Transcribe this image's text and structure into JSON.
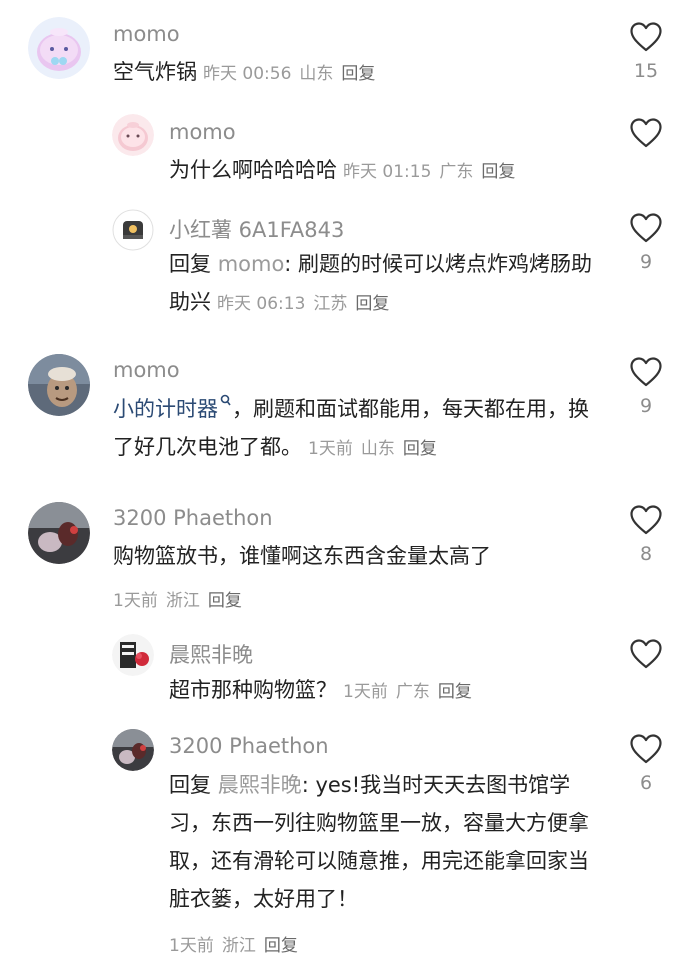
{
  "comments": [
    {
      "name": "momo",
      "text": "空气炸锅",
      "time": "昨天 00:56",
      "location": "山东",
      "reply_label": "回复",
      "likes": "15"
    },
    {
      "name": "momo",
      "text": "为什么啊哈哈哈哈",
      "time": "昨天 01:15",
      "location": "广东",
      "reply_label": "回复",
      "likes": ""
    },
    {
      "name": "小红薯 6A1FA843",
      "reply_prefix": "回复",
      "mention": "momo",
      "text": ": 刷题的时候可以烤点炸鸡烤肠助助兴",
      "time": "昨天 06:13",
      "location": "江苏",
      "reply_label": "回复",
      "likes": "9"
    },
    {
      "name": "momo",
      "link_text": "小的计时器",
      "link_icon": "search-icon",
      "text": "，刷题和面试都能用，每天都在用，换了好几次电池了都。",
      "time": "1天前",
      "location": "山东",
      "reply_label": "回复",
      "likes": "9"
    },
    {
      "name": "3200 Phaethon",
      "text": "购物篮放书，谁懂啊这东西含金量太高了",
      "time": "1天前",
      "location": "浙江",
      "reply_label": "回复",
      "likes": "8"
    },
    {
      "name": "晨熙非晚",
      "text": "超市那种购物篮？",
      "time": "1天前",
      "location": "广东",
      "reply_label": "回复",
      "likes": ""
    },
    {
      "name": "3200 Phaethon",
      "reply_prefix": "回复",
      "mention": "晨熙非晚",
      "text": ": yes!我当时天天去图书馆学习，东西一列往购物篮里一放，容量大方便拿取，还有滑轮可以随意推，用完还能拿回家当脏衣篓，太好用了！",
      "time": "1天前",
      "location": "浙江",
      "reply_label": "回复",
      "likes": "6"
    }
  ],
  "icons": {
    "like": "heart-outline-icon"
  },
  "colors": {
    "name": "#8c8c8c",
    "text": "#222222",
    "link": "#2b4a74",
    "meta": "#9a9a9a"
  }
}
